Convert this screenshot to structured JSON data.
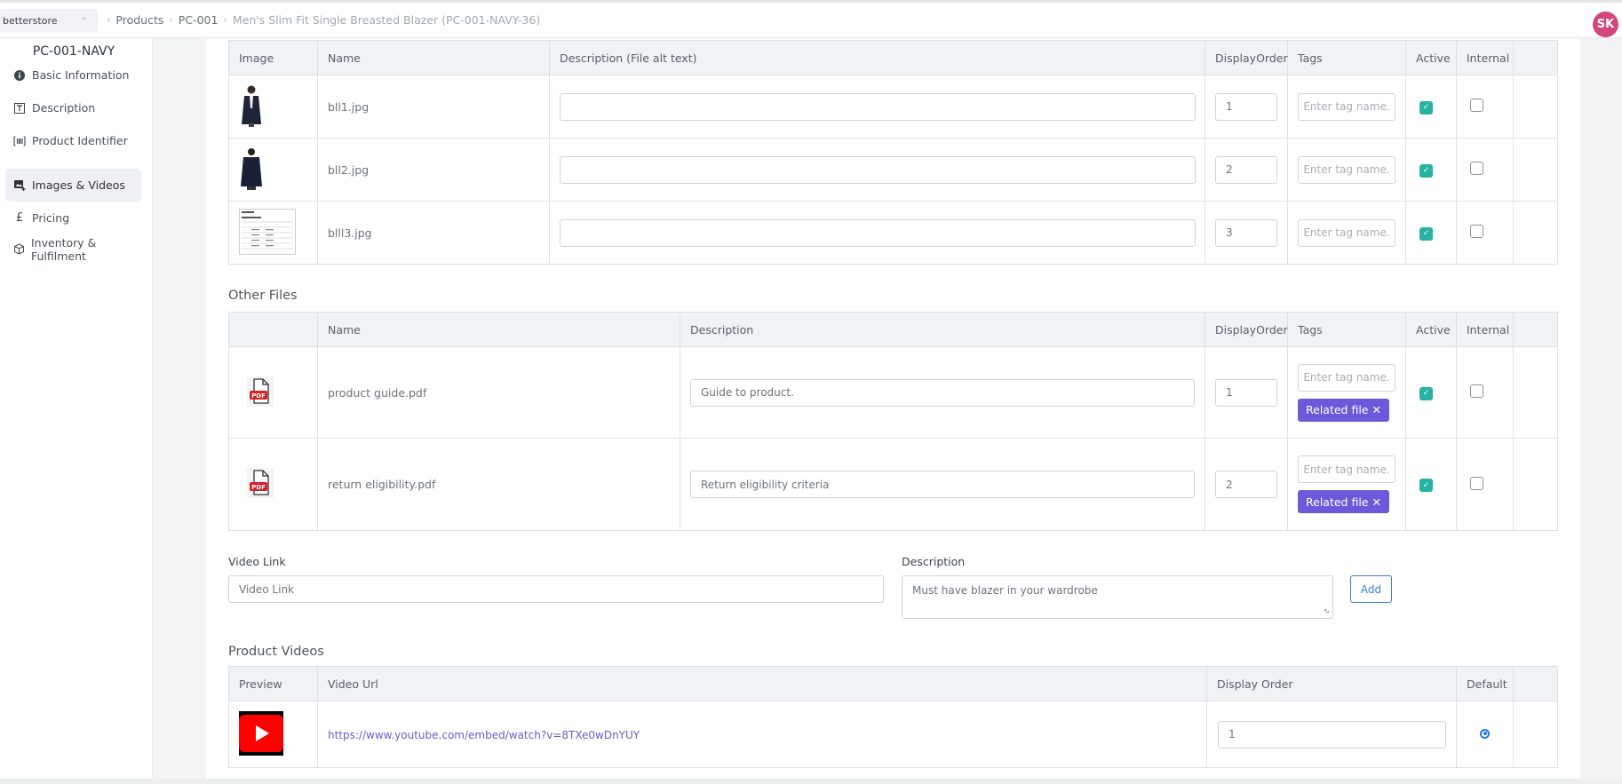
{
  "header": {
    "store": "betterstore",
    "breadcrumb": [
      "Products",
      "PC-001",
      "Men's Slim Fit Single Breasted Blazer (PC-001-NAVY-36)"
    ],
    "avatar_initials": "SK"
  },
  "sidebar": {
    "sku": "PC-001-NAVY",
    "items": [
      {
        "label": "Basic Information",
        "icon": "info-icon",
        "active": false
      },
      {
        "label": "Description",
        "icon": "text-box-icon",
        "active": false
      },
      {
        "label": "Product Identifier",
        "icon": "barcode-icon",
        "active": false
      },
      {
        "label": "Images & Videos",
        "icon": "image-add-icon",
        "active": true
      },
      {
        "label": "Pricing",
        "icon": "pound-icon",
        "active": false
      },
      {
        "label": "Inventory & Fulfilment",
        "icon": "box-icon",
        "active": false
      }
    ]
  },
  "images_table": {
    "headers": [
      "Image",
      "Name",
      "Description (File alt text)",
      "DisplayOrder",
      "Tags",
      "Active",
      "Internal",
      ""
    ],
    "rows": [
      {
        "name": "bll1.jpg",
        "description": "",
        "display_order": "1",
        "tag_placeholder": "Enter tag name.",
        "active": true,
        "internal": false,
        "thumb": "blazer-front"
      },
      {
        "name": "bll2.jpg",
        "description": "",
        "display_order": "2",
        "tag_placeholder": "Enter tag name.",
        "active": true,
        "internal": false,
        "thumb": "blazer-back"
      },
      {
        "name": "blll3.jpg",
        "description": "",
        "display_order": "3",
        "tag_placeholder": "Enter tag name.",
        "active": true,
        "internal": false,
        "thumb": "size-chart"
      }
    ]
  },
  "other_files": {
    "title": "Other Files",
    "headers": [
      "",
      "Name",
      "Description",
      "DisplayOrder",
      "Tags",
      "Active",
      "Internal",
      ""
    ],
    "rows": [
      {
        "name": "product guide.pdf",
        "description": "Guide to product.",
        "display_order": "1",
        "tag_placeholder": "Enter tag name.",
        "tag": "Related file",
        "active": true,
        "internal": false
      },
      {
        "name": "return eligibility.pdf",
        "description": "Return eligibility criteria",
        "display_order": "2",
        "tag_placeholder": "Enter tag name.",
        "tag": "Related file",
        "active": true,
        "internal": false
      }
    ]
  },
  "video_form": {
    "link_label": "Video Link",
    "link_placeholder": "Video Link",
    "description_label": "Description",
    "description_value": "Must have blazer in your wardrobe",
    "add_label": "Add"
  },
  "product_videos": {
    "title": "Product Videos",
    "headers": [
      "Preview",
      "Video Url",
      "Display Order",
      "Default",
      ""
    ],
    "rows": [
      {
        "url": "https://www.youtube.com/embed/watch?v=8TXe0wDnYUY",
        "display_order": "1",
        "default": true
      }
    ]
  },
  "colors": {
    "accent": "#6a5ad9",
    "active_check": "#27b3a3",
    "avatar": "#d4477a",
    "link_button": "#3b7de0"
  }
}
